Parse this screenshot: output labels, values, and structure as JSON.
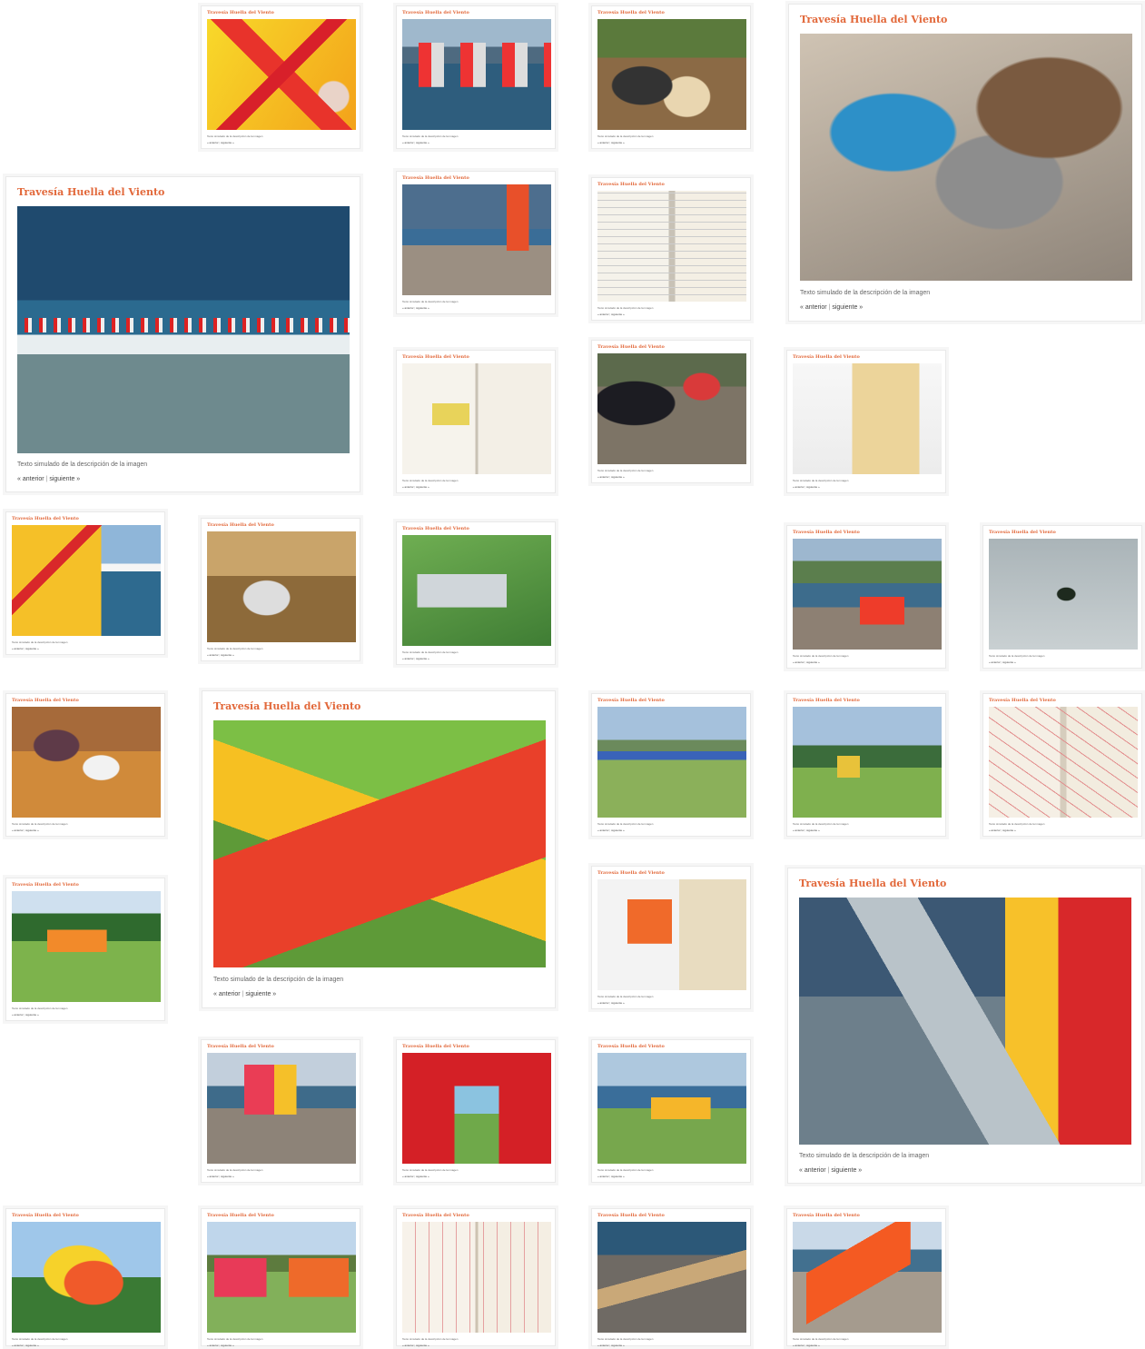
{
  "gallery": {
    "card_title": "Travesía Huella del Viento",
    "caption": "Texto simulado de la descripción de la imagen",
    "nav": {
      "prev": "« anterior",
      "separator": "|",
      "next": "siguiente »"
    }
  },
  "colors": {
    "title": "#e2683a",
    "border": "#e9e9e9",
    "background": "#ffffff"
  },
  "photos": [
    {
      "id": "p01",
      "subject": "red and yellow inflatable kite close-up"
    },
    {
      "id": "p02",
      "subject": "panels in lake"
    },
    {
      "id": "p03",
      "subject": "children at workshop table"
    },
    {
      "id": "p04",
      "subject": "drilling metal plate"
    },
    {
      "id": "p05",
      "subject": "waves with flag line"
    },
    {
      "id": "p06",
      "subject": "beach with sail"
    },
    {
      "id": "p07",
      "subject": "sketchbook"
    },
    {
      "id": "p08",
      "subject": "sketchbook yellow"
    },
    {
      "id": "p09",
      "subject": "kids working wood"
    },
    {
      "id": "p10",
      "subject": "book with letter p"
    },
    {
      "id": "p11",
      "subject": "kite by lake"
    },
    {
      "id": "p12",
      "subject": "panels on table"
    },
    {
      "id": "p13",
      "subject": "panels on grass"
    },
    {
      "id": "p14",
      "subject": "shore with kites"
    },
    {
      "id": "p15",
      "subject": "person in water"
    },
    {
      "id": "p16",
      "subject": "indoor table work"
    },
    {
      "id": "p17",
      "subject": "tarp on slope"
    },
    {
      "id": "p18",
      "subject": "field with blue tarp"
    },
    {
      "id": "p19",
      "subject": "field with frames"
    },
    {
      "id": "p20",
      "subject": "red sketch"
    },
    {
      "id": "p21",
      "subject": "orange pyramid"
    },
    {
      "id": "p22",
      "subject": "book with pattern"
    },
    {
      "id": "p23",
      "subject": "pipe close-up"
    },
    {
      "id": "p24",
      "subject": "kites and people"
    },
    {
      "id": "p25",
      "subject": "red tent interior"
    },
    {
      "id": "p26",
      "subject": "lake pyramid"
    },
    {
      "id": "p27",
      "subject": "hex kite"
    },
    {
      "id": "p28",
      "subject": "lawn kites"
    },
    {
      "id": "p29",
      "subject": "sketch room"
    },
    {
      "id": "p30",
      "subject": "stones and boards"
    },
    {
      "id": "p31",
      "subject": "orange tent"
    }
  ]
}
